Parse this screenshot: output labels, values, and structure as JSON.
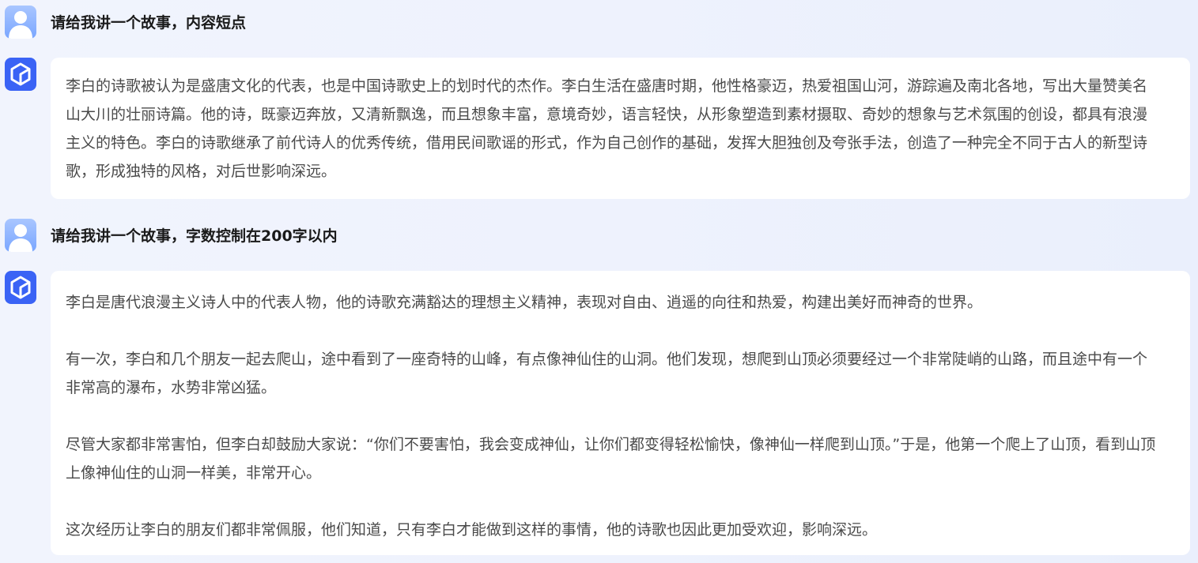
{
  "conversation": {
    "q1": "请给我讲一个故事，内容短点",
    "a1": {
      "p1": "李白的诗歌被认为是盛唐文化的代表，也是中国诗歌史上的划时代的杰作。李白生活在盛唐时期，他性格豪迈，热爱祖国山河，游踪遍及南北各地，写出大量赞美名山大川的壮丽诗篇。他的诗，既豪迈奔放，又清新飘逸，而且想象丰富，意境奇妙，语言轻快，从形象塑造到素材摄取、奇妙的想象与艺术氛围的创设，都具有浪漫主义的特色。李白的诗歌继承了前代诗人的优秀传统，借用民间歌谣的形式，作为自己创作的基础，发挥大胆独创及夸张手法，创造了一种完全不同于古人的新型诗歌，形成独特的风格，对后世影响深远。"
    },
    "q2": "请给我讲一个故事，字数控制在200字以内",
    "a2": {
      "p1": "李白是唐代浪漫主义诗人中的代表人物，他的诗歌充满豁达的理想主义精神，表现对自由、逍遥的向往和热爱，构建出美好而神奇的世界。",
      "p2": "有一次，李白和几个朋友一起去爬山，途中看到了一座奇特的山峰，有点像神仙住的山洞。他们发现，想爬到山顶必须要经过一个非常陡峭的山路，而且途中有一个非常高的瀑布，水势非常凶猛。",
      "p3": "尽管大家都非常害怕，但李白却鼓励大家说：“你们不要害怕，我会变成神仙，让你们都变得轻松愉快，像神仙一样爬到山顶。”于是，他第一个爬上了山顶，看到山顶上像神仙住的山洞一样美，非常开心。",
      "p4": "这次经历让李白的朋友们都非常佩服，他们知道，只有李白才能做到这样的事情，他的诗歌也因此更加受欢迎，影响深远。"
    }
  },
  "icons": {
    "user_avatar": "user-icon",
    "bot_avatar": "hexagon-cube-logo-icon"
  },
  "colors": {
    "bot_avatar_bg": "#3a63f5",
    "user_avatar_bg": "#8fb4ff",
    "card_bg": "#ffffff",
    "answer_text": "#4a4a4a"
  }
}
